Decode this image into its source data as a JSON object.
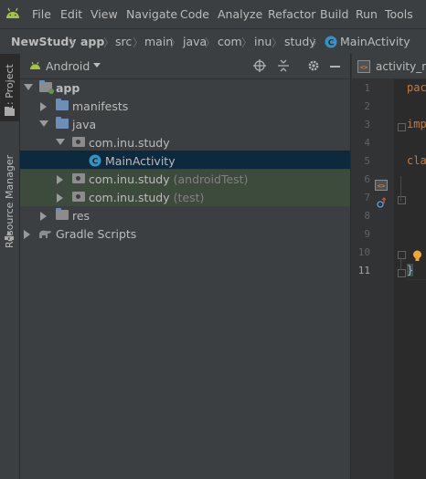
{
  "menu": {
    "items": [
      "File",
      "Edit",
      "View",
      "Navigate",
      "Code",
      "Analyze",
      "Refactor",
      "Build",
      "Run",
      "Tools"
    ]
  },
  "breadcrumb": [
    "NewStudy",
    "app",
    "src",
    "main",
    "java",
    "com",
    "inu",
    "study",
    "MainActivity"
  ],
  "side_tabs": {
    "project": "1: Project",
    "resource_manager": "Resource Manager"
  },
  "project_panel": {
    "view_mode": "Android"
  },
  "tree": [
    {
      "label": "app",
      "suffix": ""
    },
    {
      "label": "manifests",
      "suffix": ""
    },
    {
      "label": "java",
      "suffix": ""
    },
    {
      "label": "com.inu.study",
      "suffix": ""
    },
    {
      "label": "MainActivity",
      "suffix": ""
    },
    {
      "label": "com.inu.study",
      "suffix": "(androidTest)"
    },
    {
      "label": "com.inu.study",
      "suffix": "(test)"
    },
    {
      "label": "res",
      "suffix": ""
    },
    {
      "label": "Gradle Scripts",
      "suffix": ""
    }
  ],
  "editor": {
    "tab_label": "activity_ma",
    "line_numbers": [
      "1",
      "2",
      "3",
      "4",
      "5",
      "6",
      "7",
      "8",
      "9",
      "10",
      "11"
    ],
    "code": {
      "line1": "pac",
      "line3": "imp",
      "line6": "cla",
      "line11": "}"
    }
  },
  "colors": {
    "menu_bg": "#3c3f41",
    "editor_bg": "#2b2b2b",
    "selection": "#0d293e",
    "test_highlight": "#3d4b3d",
    "android_green": "#a4c639"
  }
}
